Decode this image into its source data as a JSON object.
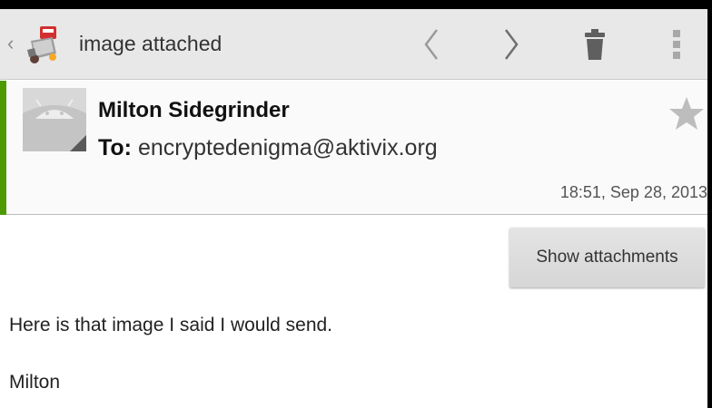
{
  "actionbar": {
    "title": "image attached",
    "icons": [
      "back-chevron-icon",
      "app-icon",
      "previous-icon",
      "next-icon",
      "trash-icon",
      "overflow-menu-icon"
    ]
  },
  "header": {
    "sender": "Milton Sidegrinder",
    "to_label": "To:",
    "to_address": "encryptedenigma@aktivix.org",
    "date": "18:51, Sep 28, 2013",
    "starred": false
  },
  "body": {
    "show_attachments_label": "Show attachments",
    "lines": [
      "Here is that image I said I would send.",
      "Milton"
    ]
  },
  "colors": {
    "accent": "#4c9a00",
    "actionbar_bg": "#e8e8e8",
    "button_bg": "#dcdcdc"
  }
}
